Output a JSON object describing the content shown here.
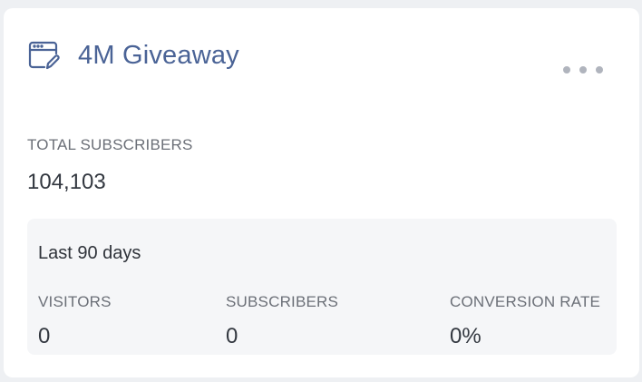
{
  "card": {
    "title": "4M Giveaway",
    "title_icon": "browser-edit-icon",
    "more_icon": "more-horizontal-icon",
    "accent_color": "#4a6396"
  },
  "totals": {
    "label": "TOTAL SUBSCRIBERS",
    "value": "104,103"
  },
  "stats": {
    "period": "Last 90 days",
    "items": [
      {
        "label": "VISITORS",
        "value": "0"
      },
      {
        "label": "SUBSCRIBERS",
        "value": "0"
      },
      {
        "label": "CONVERSION RATE",
        "value": "0%"
      }
    ]
  }
}
